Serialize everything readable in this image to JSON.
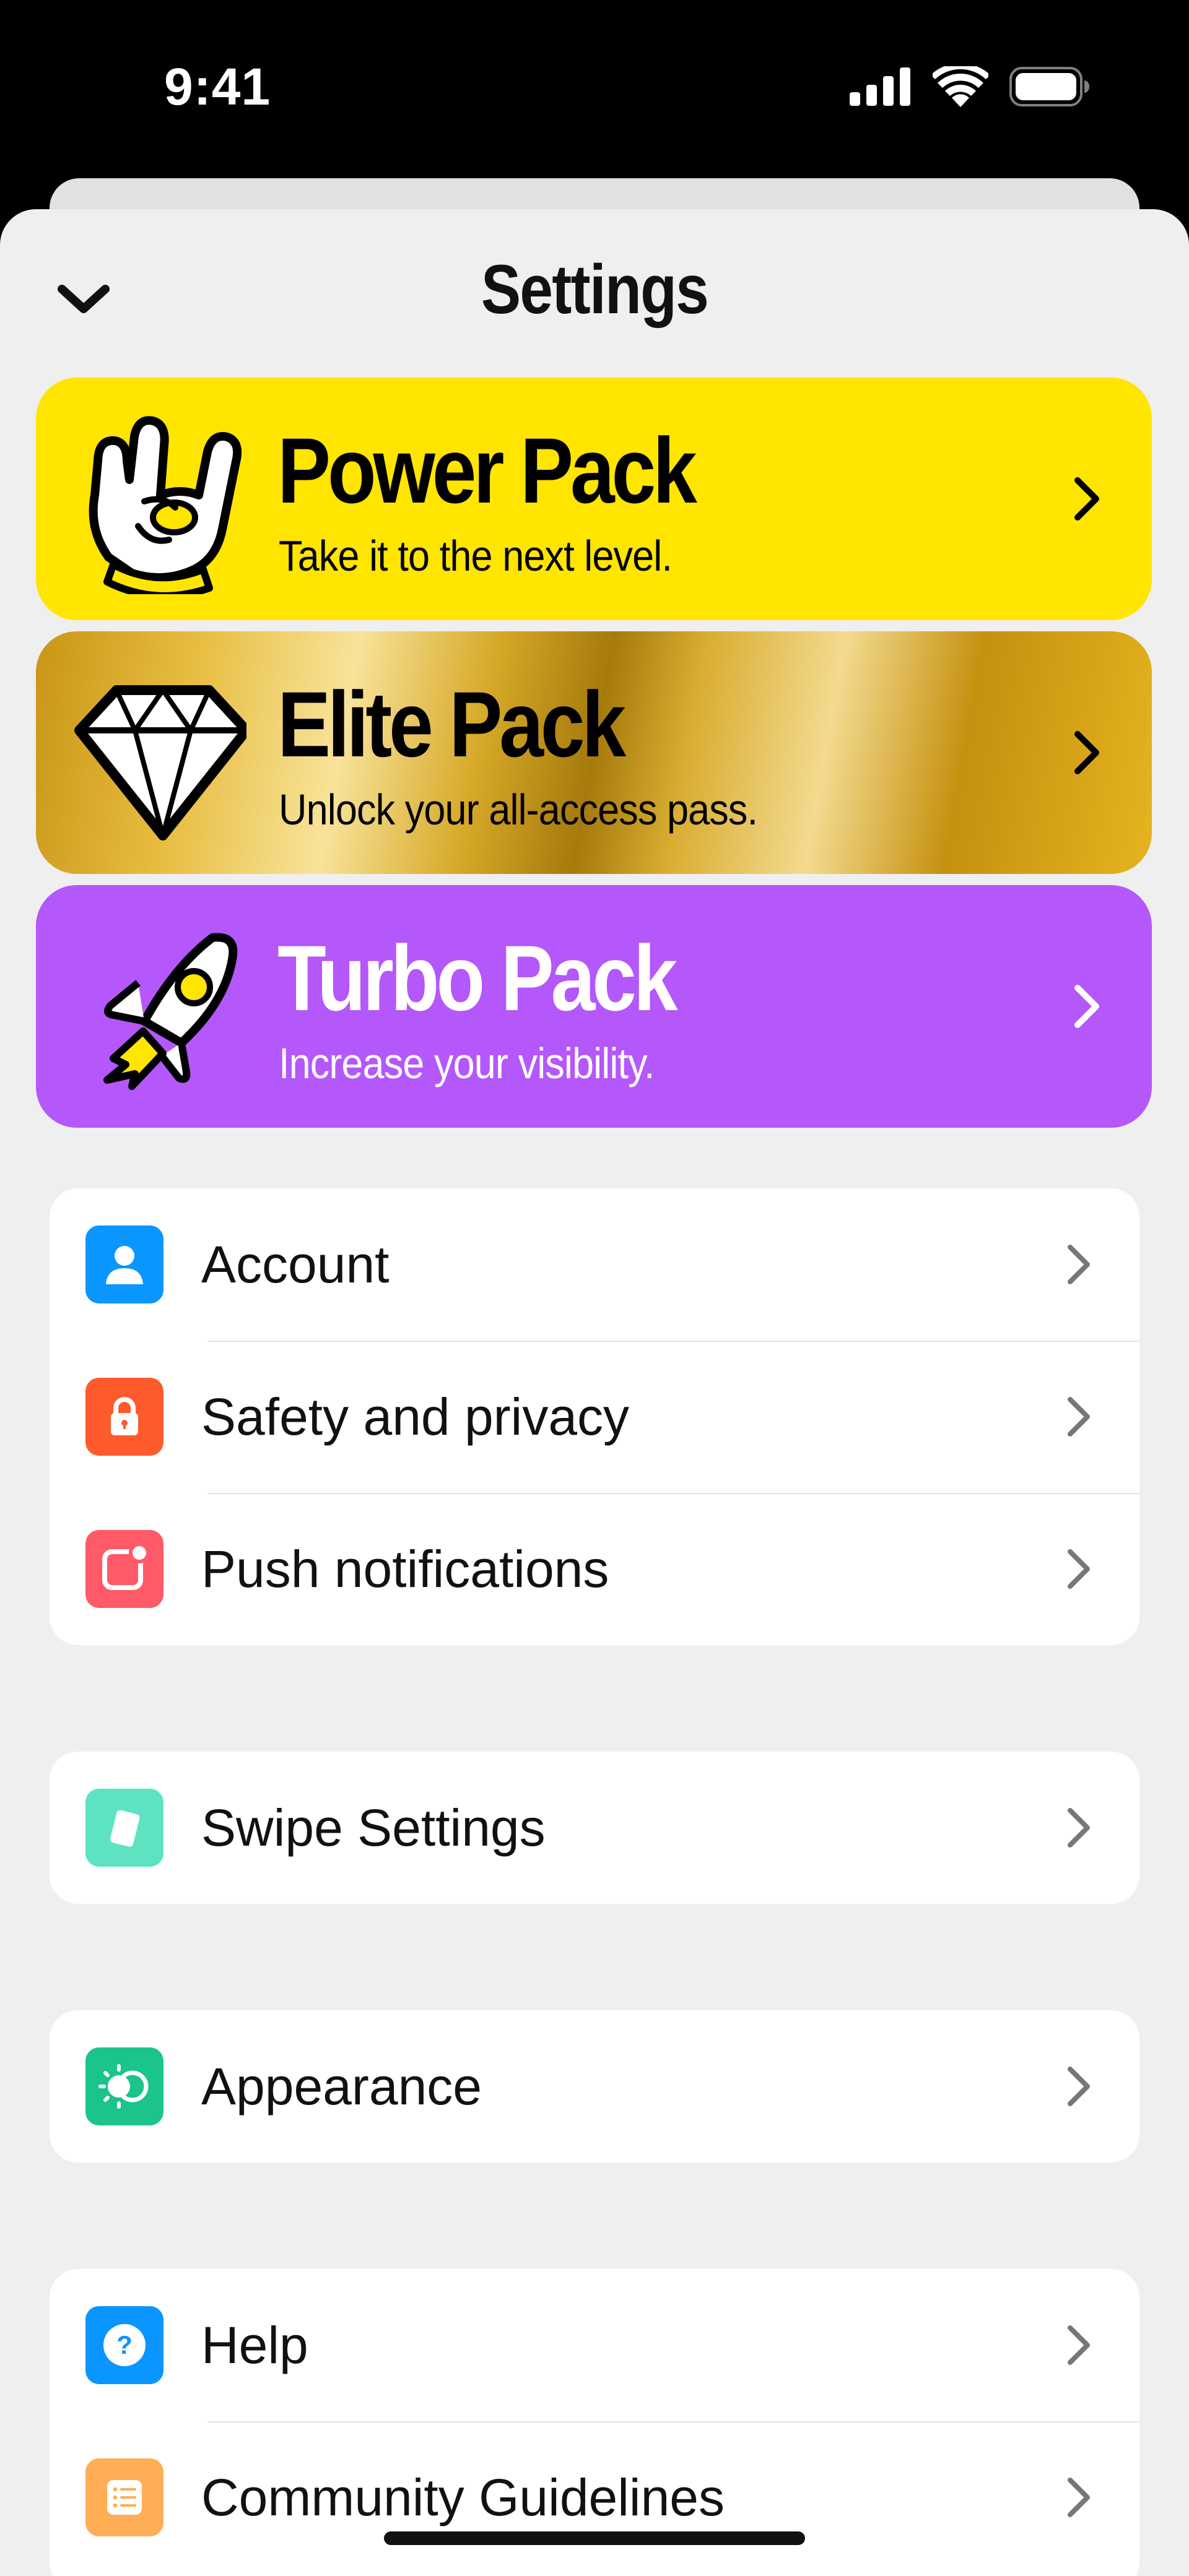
{
  "status_bar": {
    "time": "9:41"
  },
  "header": {
    "title": "Settings"
  },
  "packs": [
    {
      "id": "power",
      "title": "Power Pack",
      "subtitle": "Take it to the next level.",
      "icon": "rock-hand-icon",
      "color": "#ffe500"
    },
    {
      "id": "elite",
      "title": "Elite Pack",
      "subtitle": "Unlock your all-access pass.",
      "icon": "diamond-icon",
      "color": "#d9ad31"
    },
    {
      "id": "turbo",
      "title": "Turbo Pack",
      "subtitle": "Increase your visibility.",
      "icon": "rocket-icon",
      "color": "#b457fb"
    }
  ],
  "groups": [
    {
      "items": [
        {
          "label": "Account",
          "icon": "person-icon",
          "icon_color": "#0a95ff"
        },
        {
          "label": "Safety and privacy",
          "icon": "lock-icon",
          "icon_color": "#ff5a2c"
        },
        {
          "label": "Push notifications",
          "icon": "notification-icon",
          "icon_color": "#ff5a67"
        }
      ]
    },
    {
      "items": [
        {
          "label": "Swipe Settings",
          "icon": "card-icon",
          "icon_color": "#5ee3c2"
        }
      ]
    },
    {
      "items": [
        {
          "label": "Appearance",
          "icon": "appearance-icon",
          "icon_color": "#1bc48a"
        }
      ]
    },
    {
      "items": [
        {
          "label": "Help",
          "icon": "help-icon",
          "icon_color": "#0a95ff"
        },
        {
          "label": "Community Guidelines",
          "icon": "guidelines-icon",
          "icon_color": "#ffae55"
        }
      ]
    }
  ]
}
